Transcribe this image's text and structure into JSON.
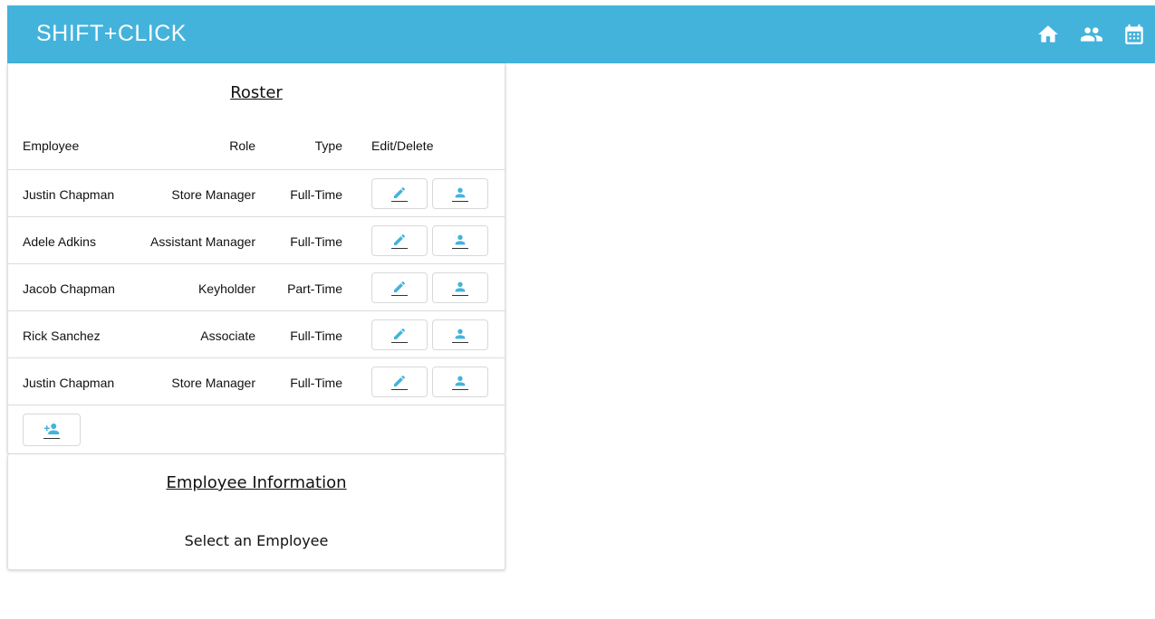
{
  "app": {
    "brand": "SHIFT+CLICK",
    "accent_color": "#43b3dc",
    "nav_icons": [
      "home-icon",
      "people-icon",
      "calendar-icon"
    ]
  },
  "roster": {
    "title": "Roster",
    "headers": {
      "employee": "Employee",
      "role": "Role",
      "type": "Type",
      "actions": "Edit/Delete"
    },
    "rows": [
      {
        "employee": "Justin Chapman",
        "role": "Store Manager",
        "type": "Full-Time"
      },
      {
        "employee": "Adele Adkins",
        "role": "Assistant Manager",
        "type": "Full-Time"
      },
      {
        "employee": "Jacob Chapman",
        "role": "Keyholder",
        "type": "Part-Time"
      },
      {
        "employee": "Rick Sanchez",
        "role": "Associate",
        "type": "Full-Time"
      },
      {
        "employee": "Justin Chapman",
        "role": "Store Manager",
        "type": "Full-Time"
      }
    ],
    "row_icons": {
      "edit": "pencil-icon",
      "delete": "person-icon"
    },
    "add_icon": "person-add-icon"
  },
  "info": {
    "title": "Employee Information",
    "message": "Select an Employee"
  }
}
